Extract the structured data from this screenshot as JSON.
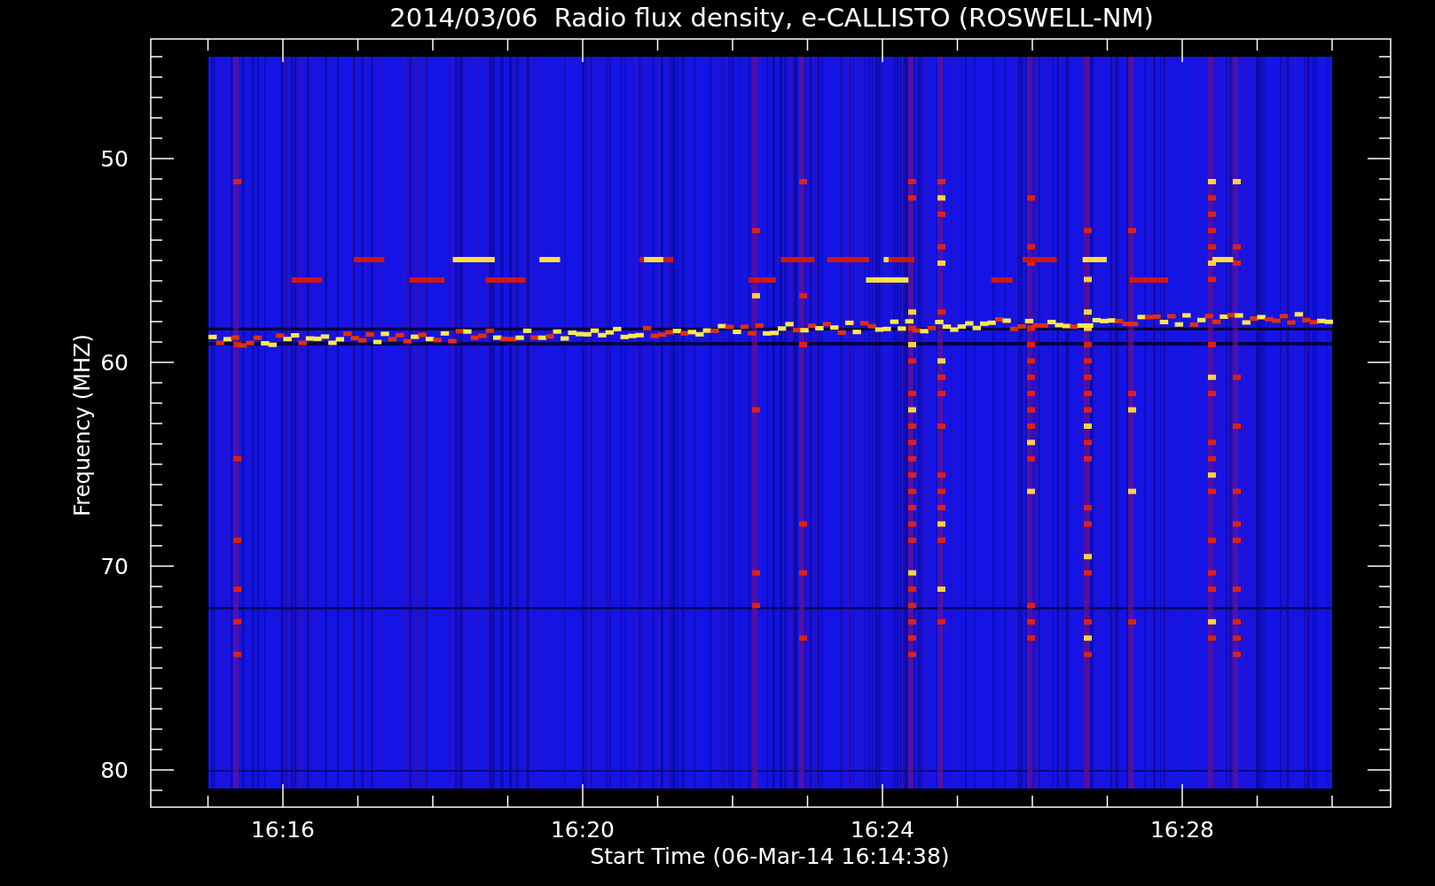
{
  "title": "2014/03/06  Radio flux density, e-CALLISTO (ROSWELL-NM)",
  "y_axis": {
    "label": "Frequency (MHZ)",
    "ticks": [
      "50",
      "60",
      "70",
      "80"
    ]
  },
  "x_axis": {
    "label": "Start Time (06-Mar-14 16:14:38)",
    "ticks": [
      "16:16",
      "16:20",
      "16:24",
      "16:28"
    ]
  }
}
